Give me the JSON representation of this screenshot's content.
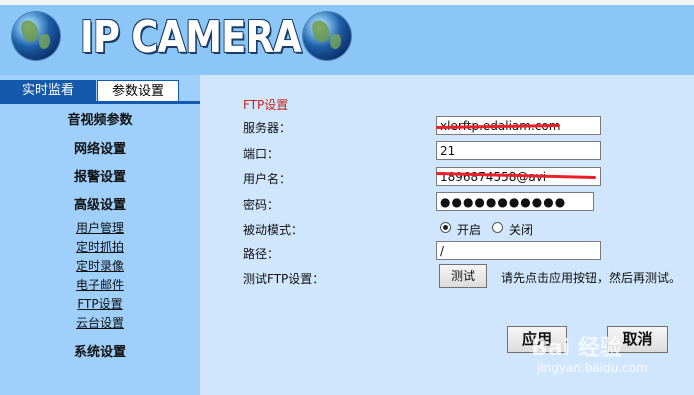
{
  "header": {
    "logo_text": "IP CAMERA"
  },
  "tabs": {
    "live": "实时监看",
    "params": "参数设置"
  },
  "sidebar": {
    "av": "音视频参数",
    "network": "网络设置",
    "alarm": "报警设置",
    "advanced": "高级设置",
    "sub": [
      "用户管理",
      "定时抓拍",
      "定时录像",
      "电子邮件",
      "FTP设置",
      "云台设置"
    ],
    "system": "系统设置"
  },
  "ftp": {
    "title": "FTP设置",
    "server_label": "服务器：",
    "server_value": "xlerftp.edaliam.com",
    "port_label": "端口：",
    "port_value": "21",
    "user_label": "用户名：",
    "user_value": "1896874558@avi",
    "pass_label": "密码：",
    "pass_value": "●●●●●●●●●●●",
    "mode_label": "被动模式：",
    "mode_on": "开启",
    "mode_off": "关闭",
    "path_label": "路径：",
    "path_value": "/",
    "test_label": "测试FTP设置：",
    "test_button": "测试",
    "test_hint": "请先点击应用按钮，然后再测试。"
  },
  "actions": {
    "apply": "应用",
    "cancel": "取消"
  },
  "watermark": {
    "brand": "Bai 经验",
    "url": "jingyan.baidu.com"
  },
  "colors": {
    "tab_active": "#1559ad",
    "title_red": "#cc2222",
    "header_blue": "#8cc6f6"
  }
}
